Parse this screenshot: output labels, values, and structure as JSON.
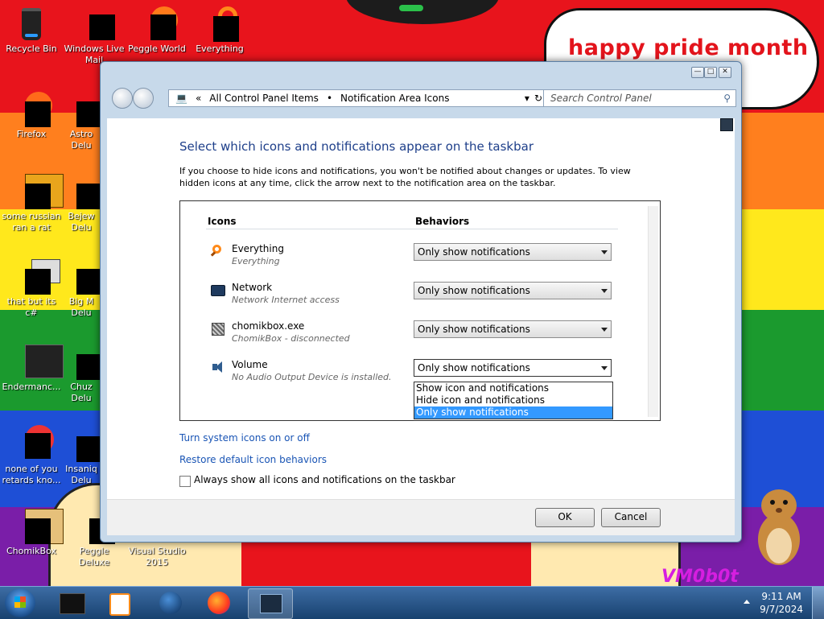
{
  "desktop": {
    "banner_text": "happy pride month",
    "watermark_text": "VM0b0t",
    "icons": [
      {
        "label": "Recycle Bin"
      },
      {
        "label": "Windows Live Mail"
      },
      {
        "label": "Peggle World"
      },
      {
        "label": "Everything"
      },
      {
        "label": "Firefox"
      },
      {
        "label": "Astro Delu"
      },
      {
        "label": "some russian ran a rat"
      },
      {
        "label": "Bejew Delu"
      },
      {
        "label": "that but its c#"
      },
      {
        "label": "Big M Delu"
      },
      {
        "label": "Endermanc..."
      },
      {
        "label": "Chuz Delu"
      },
      {
        "label": "none of you retards kno..."
      },
      {
        "label": "Insaniq Delu"
      },
      {
        "label": "ChomikBox"
      },
      {
        "label": "Peggle Deluxe"
      },
      {
        "label": "Visual Studio 2015"
      }
    ]
  },
  "window": {
    "breadcrumb": {
      "items": [
        "All Control Panel Items",
        "Notification Area Icons"
      ],
      "separator": "•"
    },
    "search_placeholder": "Search Control Panel",
    "heading": "Select which icons and notifications appear on the taskbar",
    "intro": "If you choose to hide icons and notifications, you won't be notified about changes or updates. To view hidden icons at any time, click the arrow next to the notification area on the taskbar.",
    "columns": {
      "icons": "Icons",
      "behaviors": "Behaviors"
    },
    "rows": [
      {
        "name": "Everything",
        "sub": "Everything",
        "behavior": "Only show notifications",
        "icon": "magnifier-icon"
      },
      {
        "name": "Network",
        "sub": "Network Internet access",
        "behavior": "Only show notifications",
        "icon": "network-icon"
      },
      {
        "name": "chomikbox.exe",
        "sub": "ChomikBox - disconnected",
        "behavior": "Only show notifications",
        "icon": "chomikbox-icon"
      },
      {
        "name": "Volume",
        "sub": "No Audio Output Device is installed.",
        "behavior": "Only show notifications",
        "icon": "speaker-icon"
      }
    ],
    "dropdown_options": [
      "Show icon and notifications",
      "Hide icon and notifications",
      "Only show notifications"
    ],
    "dropdown_selected_index": 2,
    "links": {
      "system_icons": "Turn system icons on or off",
      "restore": "Restore default icon behaviors"
    },
    "always_show_label": "Always show all icons and notifications on the taskbar",
    "always_show_checked": false,
    "ok_label": "OK",
    "cancel_label": "Cancel"
  },
  "taskbar": {
    "time": "9:11 AM",
    "date": "9/7/2024"
  },
  "colors": {
    "link": "#1a55b5",
    "heading": "#1e3f8a",
    "selection": "#3399ff",
    "banner": "#e3141c"
  }
}
